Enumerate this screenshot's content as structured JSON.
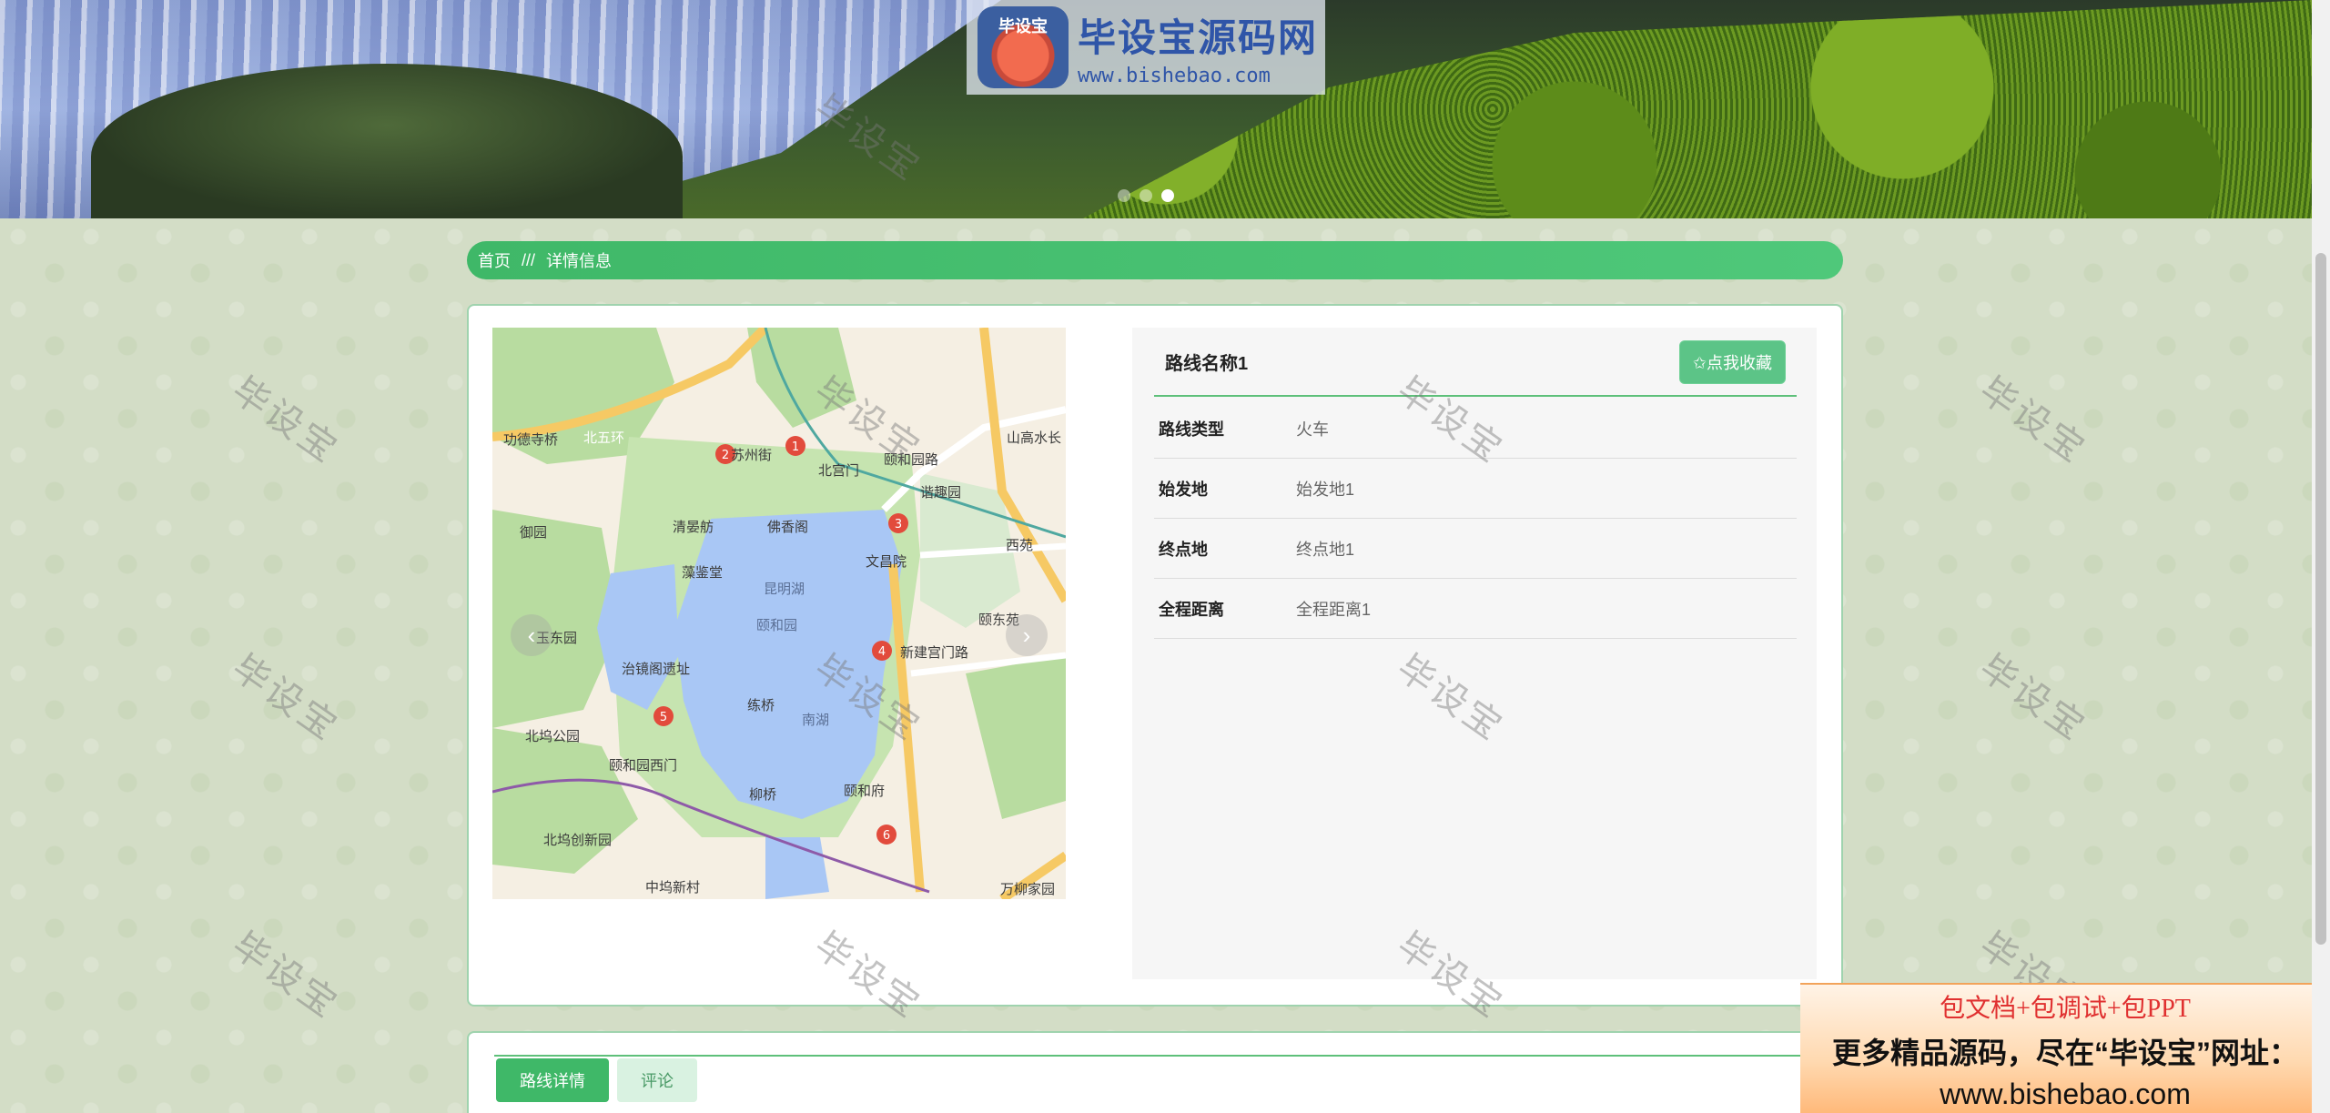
{
  "banner": {
    "logo_badge": "毕设宝",
    "logo_title": "毕设宝源码网",
    "logo_url": "www.bishebao.com",
    "slide_count": 3,
    "active_slide": 3
  },
  "breadcrumb": {
    "home": "首页",
    "separator": "///",
    "current": "详情信息"
  },
  "detail": {
    "route_name": "路线名称1",
    "favorite_label": "✩点我收藏",
    "fields": [
      {
        "key": "路线类型",
        "value": "火车"
      },
      {
        "key": "始发地",
        "value": "始发地1"
      },
      {
        "key": "终点地",
        "value": "终点地1"
      },
      {
        "key": "全程距离",
        "value": "全程距离1"
      }
    ],
    "prev_arrow": "‹",
    "next_arrow": "›"
  },
  "map": {
    "labels": [
      "功德寺桥",
      "北五环",
      "苏州街",
      "北宫门",
      "颐和园路",
      "谐趣园",
      "山高水长",
      "御园",
      "清晏舫",
      "佛香阁",
      "西苑",
      "文昌院",
      "藻鉴堂",
      "昆明湖",
      "颐和园",
      "颐东苑",
      "玉东园",
      "治镜阁遗址",
      "新建宫门路",
      "练桥",
      "北坞公园",
      "颐和园西门",
      "南湖",
      "柳桥",
      "颐和府",
      "北坞创新园",
      "中坞新村",
      "万柳家园"
    ],
    "markers": [
      "1",
      "2",
      "3",
      "4",
      "5",
      "6"
    ],
    "colors": {
      "water": "#a9c7f5",
      "park": "#b8dca0",
      "road": "#f6c964",
      "land": "#f5efe3"
    }
  },
  "tabs": [
    {
      "label": "路线详情",
      "active": true
    },
    {
      "label": "评论",
      "active": false
    }
  ],
  "watermark_text": "毕设宝",
  "ad": {
    "line1": "包文档+包调试+包PPT",
    "line2": "更多精品源码，尽在“毕设宝”网址：",
    "line3": "www.bishebao.com"
  },
  "colors": {
    "accent": "#3fb868",
    "button": "#5cc487",
    "page_bg": "#d3ddc6"
  }
}
